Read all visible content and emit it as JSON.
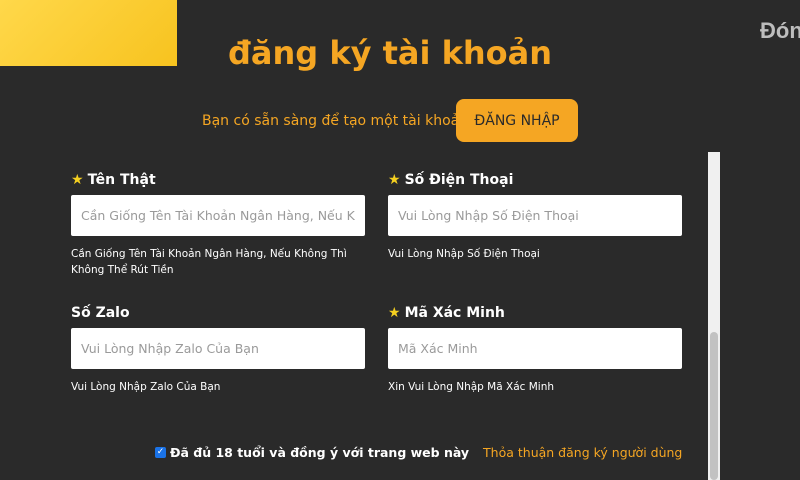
{
  "header": {
    "title": "đăng ký tài khoản",
    "corner_text": "Đón"
  },
  "login_prompt": {
    "text": "Bạn có sẵn sàng để tạo một tài khoản ?",
    "button_label": "ĐĂNG NHẬP"
  },
  "fields": [
    {
      "label": "Tên Thật",
      "required": true,
      "placeholder": "Cần Giống Tên Tài Khoản Ngân Hàng, Nếu Không Thì Không Thể Rút Tiền",
      "value": "",
      "helper": "Cần Giống Tên Tài Khoản Ngân Hàng, Nếu Không Thì Không Thể Rút Tiền"
    },
    {
      "label": "Số Điện Thoại",
      "required": true,
      "placeholder": "Vui Lòng Nhập Số Điện Thoại",
      "value": "",
      "helper": "Vui Lòng Nhập Số Điện Thoại"
    },
    {
      "label": "Số Zalo",
      "required": false,
      "placeholder": "Vui Lòng Nhập Zalo Của Bạn",
      "value": "",
      "helper": "Vui Lòng Nhập Zalo Của Bạn"
    },
    {
      "label": "Mã Xác Minh",
      "required": true,
      "placeholder": "Mã Xác Minh",
      "value": "",
      "helper": "Xin Vui Lòng Nhập Mã Xác Minh"
    }
  ],
  "terms": {
    "checked": true,
    "text": "Đã đủ 18 tuổi và đồng ý với trang web này",
    "link_text": "Thỏa thuận đăng ký người dùng"
  },
  "colors": {
    "background": "#2a2a2a",
    "accent": "#f5a623",
    "star": "#f5d020",
    "checkbox": "#1a73e8"
  },
  "icons": {
    "required_marker": "star-icon",
    "checkbox_mark": "check-icon"
  }
}
